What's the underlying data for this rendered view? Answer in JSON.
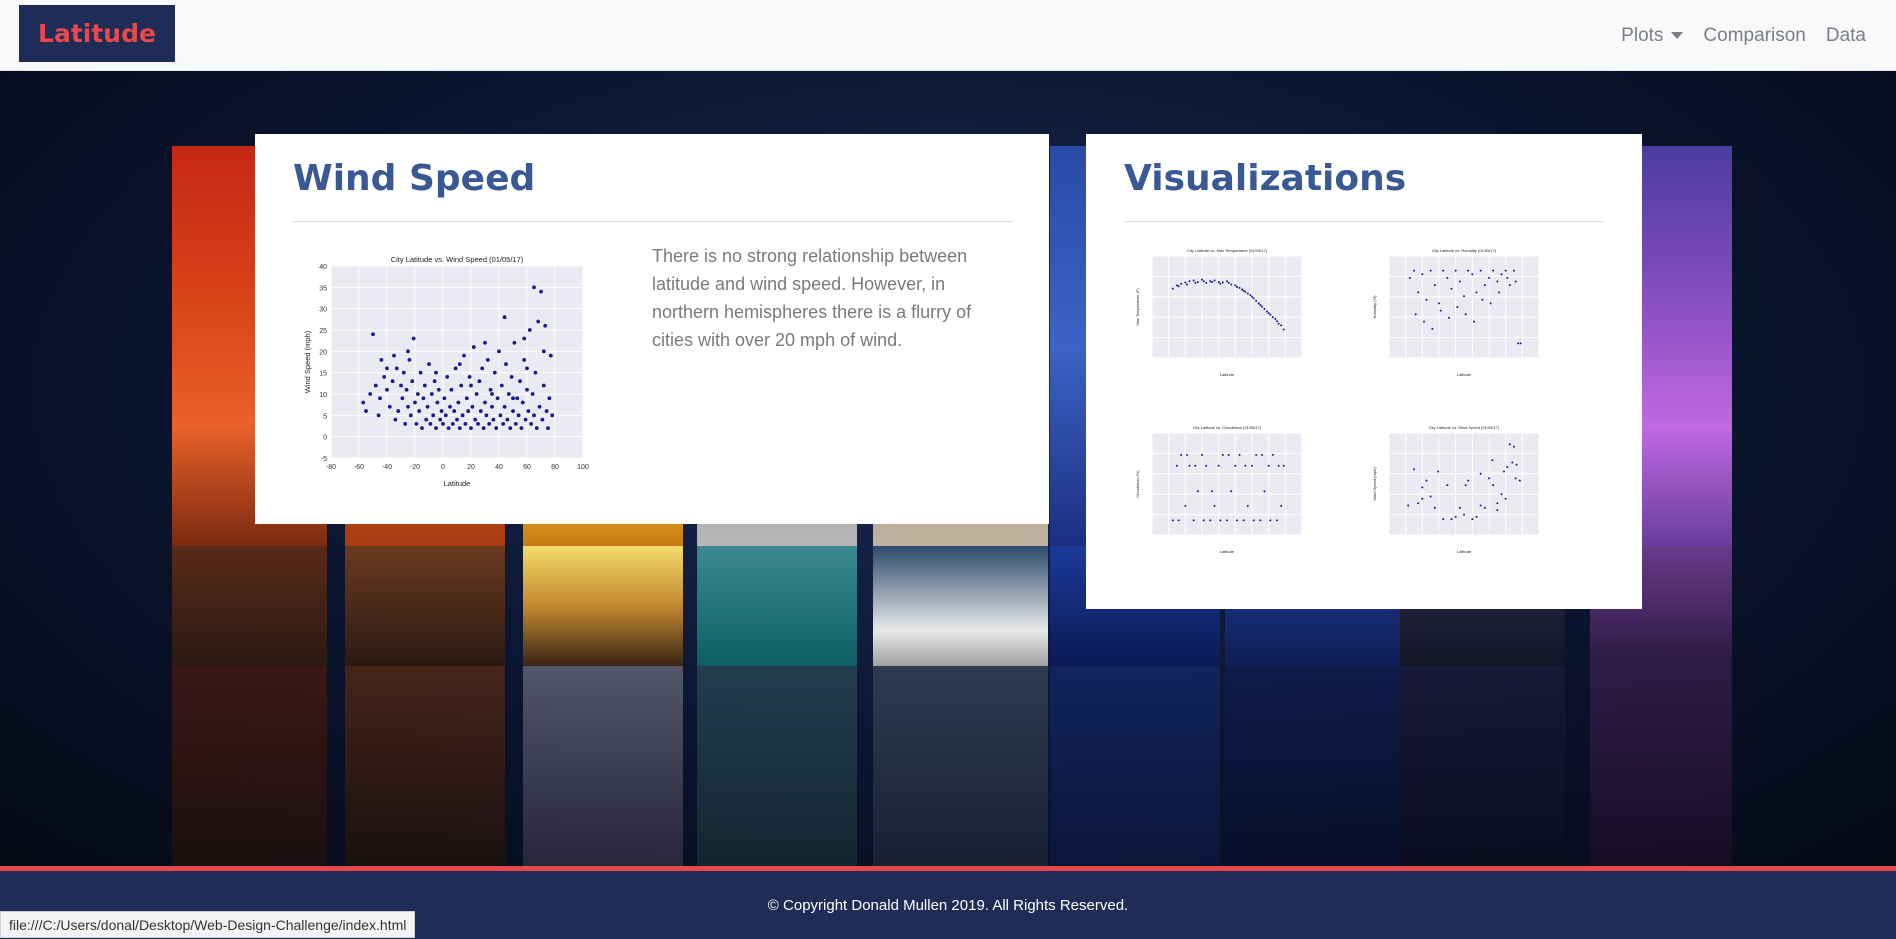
{
  "navbar": {
    "brand": "Latitude",
    "items": [
      {
        "label": "Plots",
        "dropdown": true
      },
      {
        "label": "Comparison"
      },
      {
        "label": "Data"
      }
    ]
  },
  "wind_card": {
    "title": "Wind Speed",
    "description": "There is no strong relationship between latitude and wind speed. However, in northern hemispheres there is a flurry of cities with over 20 mph of wind."
  },
  "vis_card": {
    "title": "Visualizations"
  },
  "footer": {
    "text": "© Copyright Donald Mullen 2019. All Rights Reserved."
  },
  "statusbar": {
    "url": "file:///C:/Users/donal/Desktop/Web-Design-Challenge/index.html"
  },
  "colors": {
    "brand_bg": "#1f2d56",
    "brand_text": "#e8474d",
    "title": "#3a5894",
    "footer_bg": "#1f2d56",
    "footer_accent": "#e8474d",
    "plot_bg": "#eaeaf2",
    "point": "#1a1a8c"
  },
  "chart_data": [
    {
      "type": "scatter",
      "id": "main",
      "title": "City Latitude vs. Wind Speed (01/05/17)",
      "xlabel": "Latitude",
      "ylabel": "Wind Speed (mph)",
      "xlim": [
        -80,
        100
      ],
      "ylim": [
        -5,
        40
      ],
      "xticks": [
        -80,
        -60,
        -40,
        -20,
        0,
        20,
        40,
        60,
        80,
        100
      ],
      "yticks": [
        -5,
        0,
        5,
        10,
        15,
        20,
        25,
        30,
        35,
        40
      ],
      "grid": true,
      "points": [
        [
          -57,
          8
        ],
        [
          -55,
          6
        ],
        [
          -52,
          10
        ],
        [
          -50,
          24
        ],
        [
          -48,
          12
        ],
        [
          -46,
          5
        ],
        [
          -45,
          9
        ],
        [
          -44,
          18
        ],
        [
          -42,
          14
        ],
        [
          -40,
          11
        ],
        [
          -38,
          7
        ],
        [
          -36,
          13
        ],
        [
          -35,
          19
        ],
        [
          -34,
          4
        ],
        [
          -33,
          16
        ],
        [
          -32,
          6
        ],
        [
          -30,
          12
        ],
        [
          -29,
          9
        ],
        [
          -28,
          15
        ],
        [
          -27,
          3
        ],
        [
          -26,
          11
        ],
        [
          -25,
          7
        ],
        [
          -24,
          18
        ],
        [
          -23,
          5
        ],
        [
          -22,
          13
        ],
        [
          -21,
          23
        ],
        [
          -20,
          8
        ],
        [
          -19,
          3
        ],
        [
          -18,
          10
        ],
        [
          -17,
          6
        ],
        [
          -16,
          15
        ],
        [
          -15,
          2
        ],
        [
          -14,
          9
        ],
        [
          -13,
          12
        ],
        [
          -12,
          4
        ],
        [
          -11,
          7
        ],
        [
          -10,
          17
        ],
        [
          -9,
          3
        ],
        [
          -8,
          10
        ],
        [
          -7,
          5
        ],
        [
          -6,
          13
        ],
        [
          -5,
          2
        ],
        [
          -4,
          8
        ],
        [
          -3,
          11
        ],
        [
          -2,
          4
        ],
        [
          -1,
          6
        ],
        [
          0,
          3
        ],
        [
          1,
          9
        ],
        [
          2,
          5
        ],
        [
          3,
          14
        ],
        [
          4,
          2
        ],
        [
          5,
          7
        ],
        [
          6,
          11
        ],
        [
          7,
          3
        ],
        [
          8,
          6
        ],
        [
          9,
          16
        ],
        [
          10,
          4
        ],
        [
          11,
          8
        ],
        [
          12,
          2
        ],
        [
          13,
          12
        ],
        [
          14,
          5
        ],
        [
          15,
          19
        ],
        [
          16,
          3
        ],
        [
          17,
          9
        ],
        [
          18,
          6
        ],
        [
          19,
          14
        ],
        [
          20,
          2
        ],
        [
          21,
          7
        ],
        [
          22,
          21
        ],
        [
          23,
          4
        ],
        [
          24,
          10
        ],
        [
          25,
          3
        ],
        [
          26,
          13
        ],
        [
          27,
          6
        ],
        [
          28,
          16
        ],
        [
          29,
          2
        ],
        [
          30,
          8
        ],
        [
          31,
          5
        ],
        [
          32,
          18
        ],
        [
          33,
          3
        ],
        [
          34,
          11
        ],
        [
          35,
          7
        ],
        [
          36,
          4
        ],
        [
          37,
          15
        ],
        [
          38,
          2
        ],
        [
          39,
          9
        ],
        [
          40,
          20
        ],
        [
          41,
          5
        ],
        [
          42,
          12
        ],
        [
          43,
          3
        ],
        [
          44,
          7
        ],
        [
          45,
          17
        ],
        [
          46,
          4
        ],
        [
          47,
          10
        ],
        [
          48,
          2
        ],
        [
          49,
          14
        ],
        [
          50,
          6
        ],
        [
          51,
          22
        ],
        [
          52,
          3
        ],
        [
          53,
          9
        ],
        [
          54,
          5
        ],
        [
          55,
          13
        ],
        [
          56,
          2
        ],
        [
          57,
          8
        ],
        [
          58,
          18
        ],
        [
          59,
          4
        ],
        [
          60,
          11
        ],
        [
          61,
          6
        ],
        [
          62,
          25
        ],
        [
          63,
          3
        ],
        [
          64,
          10
        ],
        [
          65,
          5
        ],
        [
          66,
          15
        ],
        [
          67,
          2
        ],
        [
          68,
          27
        ],
        [
          69,
          7
        ],
        [
          70,
          34
        ],
        [
          71,
          4
        ],
        [
          72,
          12
        ],
        [
          73,
          26
        ],
        [
          74,
          6
        ],
        [
          75,
          2
        ],
        [
          76,
          9
        ],
        [
          77,
          19
        ],
        [
          78,
          5
        ],
        [
          65,
          35
        ],
        [
          58,
          23
        ],
        [
          44,
          28
        ],
        [
          30,
          22
        ],
        [
          -5,
          15
        ],
        [
          -25,
          20
        ],
        [
          -40,
          16
        ],
        [
          12,
          17
        ],
        [
          20,
          12
        ],
        [
          35,
          10
        ],
        [
          50,
          9
        ],
        [
          60,
          16
        ],
        [
          72,
          20
        ]
      ]
    },
    {
      "type": "scatter",
      "id": "temperature",
      "title": "City Latitude vs. Max Temperature (01/05/17)",
      "xlabel": "Latitude",
      "ylabel": "Max Temperature (F)",
      "xlim": [
        -80,
        100
      ],
      "ylim": [
        -100,
        150
      ],
      "grid": true,
      "points": [
        [
          -55,
          70
        ],
        [
          -50,
          78
        ],
        [
          -45,
          82
        ],
        [
          -40,
          85
        ],
        [
          -35,
          88
        ],
        [
          -30,
          90
        ],
        [
          -25,
          86
        ],
        [
          -20,
          92
        ],
        [
          -15,
          84
        ],
        [
          -10,
          88
        ],
        [
          -5,
          90
        ],
        [
          0,
          86
        ],
        [
          5,
          85
        ],
        [
          10,
          88
        ],
        [
          15,
          80
        ],
        [
          20,
          78
        ],
        [
          25,
          72
        ],
        [
          30,
          65
        ],
        [
          35,
          58
        ],
        [
          40,
          50
        ],
        [
          45,
          40
        ],
        [
          50,
          30
        ],
        [
          55,
          20
        ],
        [
          60,
          10
        ],
        [
          65,
          0
        ],
        [
          70,
          -10
        ],
        [
          75,
          -20
        ],
        [
          78,
          -30
        ],
        [
          -48,
          76
        ],
        [
          -38,
          80
        ],
        [
          -28,
          84
        ],
        [
          -18,
          88
        ],
        [
          -8,
          86
        ],
        [
          2,
          82
        ],
        [
          12,
          84
        ],
        [
          22,
          74
        ],
        [
          32,
          62
        ],
        [
          42,
          46
        ],
        [
          52,
          26
        ],
        [
          62,
          6
        ],
        [
          72,
          -16
        ],
        [
          48,
          34
        ],
        [
          58,
          14
        ],
        [
          68,
          -4
        ],
        [
          38,
          54
        ],
        [
          28,
          68
        ]
      ]
    },
    {
      "type": "scatter",
      "id": "humidity",
      "title": "City Latitude vs. Humidity (01/05/17)",
      "xlabel": "Latitude",
      "ylabel": "Humidity (%)",
      "xlim": [
        -80,
        100
      ],
      "ylim": [
        -20,
        120
      ],
      "grid": true,
      "points": [
        [
          -55,
          90
        ],
        [
          -50,
          100
        ],
        [
          -45,
          70
        ],
        [
          -40,
          95
        ],
        [
          -35,
          60
        ],
        [
          -30,
          100
        ],
        [
          -25,
          80
        ],
        [
          -20,
          55
        ],
        [
          -15,
          100
        ],
        [
          -10,
          90
        ],
        [
          -5,
          75
        ],
        [
          0,
          100
        ],
        [
          5,
          85
        ],
        [
          10,
          65
        ],
        [
          15,
          100
        ],
        [
          20,
          95
        ],
        [
          25,
          70
        ],
        [
          30,
          100
        ],
        [
          35,
          80
        ],
        [
          40,
          90
        ],
        [
          45,
          100
        ],
        [
          50,
          85
        ],
        [
          55,
          95
        ],
        [
          60,
          100
        ],
        [
          65,
          80
        ],
        [
          70,
          100
        ],
        [
          75,
          0
        ],
        [
          78,
          0
        ],
        [
          -48,
          40
        ],
        [
          -38,
          30
        ],
        [
          -28,
          20
        ],
        [
          -18,
          45
        ],
        [
          -8,
          35
        ],
        [
          2,
          50
        ],
        [
          12,
          40
        ],
        [
          22,
          30
        ],
        [
          32,
          60
        ],
        [
          42,
          55
        ],
        [
          52,
          70
        ],
        [
          62,
          90
        ],
        [
          72,
          85
        ]
      ]
    },
    {
      "type": "scatter",
      "id": "cloudiness",
      "title": "City Latitude vs. Cloudiness (01/05/17)",
      "xlabel": "Latitude",
      "ylabel": "Cloudiness (%)",
      "xlim": [
        -80,
        100
      ],
      "ylim": [
        -20,
        120
      ],
      "grid": true,
      "points": [
        [
          -55,
          0
        ],
        [
          -50,
          75
        ],
        [
          -45,
          90
        ],
        [
          -40,
          20
        ],
        [
          -35,
          75
        ],
        [
          -30,
          0
        ],
        [
          -25,
          40
        ],
        [
          -20,
          90
        ],
        [
          -15,
          75
        ],
        [
          -10,
          0
        ],
        [
          -5,
          20
        ],
        [
          0,
          75
        ],
        [
          5,
          90
        ],
        [
          10,
          0
        ],
        [
          15,
          40
        ],
        [
          20,
          75
        ],
        [
          25,
          90
        ],
        [
          30,
          0
        ],
        [
          35,
          20
        ],
        [
          40,
          75
        ],
        [
          45,
          90
        ],
        [
          50,
          0
        ],
        [
          55,
          40
        ],
        [
          60,
          75
        ],
        [
          65,
          90
        ],
        [
          70,
          0
        ],
        [
          75,
          20
        ],
        [
          78,
          75
        ],
        [
          -48,
          0
        ],
        [
          -38,
          90
        ],
        [
          -28,
          75
        ],
        [
          -18,
          0
        ],
        [
          -8,
          40
        ],
        [
          2,
          0
        ],
        [
          12,
          90
        ],
        [
          22,
          0
        ],
        [
          32,
          75
        ],
        [
          42,
          0
        ],
        [
          52,
          90
        ],
        [
          62,
          0
        ],
        [
          72,
          75
        ]
      ]
    },
    {
      "type": "scatter",
      "id": "wind-thumb",
      "title": "City Latitude vs. Wind Speed (01/05/17)",
      "xlabel": "Latitude",
      "ylabel": "Wind Speed (mph)",
      "xlim": [
        -80,
        100
      ],
      "ylim": [
        -5,
        40
      ],
      "grid": true,
      "points": [
        [
          -57,
          8
        ],
        [
          -50,
          24
        ],
        [
          -45,
          9
        ],
        [
          -40,
          11
        ],
        [
          -35,
          19
        ],
        [
          -30,
          12
        ],
        [
          -25,
          7
        ],
        [
          -21,
          23
        ],
        [
          -15,
          2
        ],
        [
          -10,
          17
        ],
        [
          -5,
          2
        ],
        [
          0,
          3
        ],
        [
          5,
          7
        ],
        [
          10,
          4
        ],
        [
          15,
          19
        ],
        [
          20,
          2
        ],
        [
          25,
          3
        ],
        [
          30,
          8
        ],
        [
          35,
          7
        ],
        [
          40,
          20
        ],
        [
          45,
          17
        ],
        [
          50,
          6
        ],
        [
          55,
          13
        ],
        [
          60,
          11
        ],
        [
          62,
          25
        ],
        [
          65,
          35
        ],
        [
          68,
          27
        ],
        [
          70,
          34
        ],
        [
          73,
          26
        ],
        [
          77,
          19
        ],
        [
          58,
          23
        ],
        [
          44,
          28
        ],
        [
          30,
          22
        ],
        [
          -40,
          16
        ],
        [
          12,
          17
        ],
        [
          50,
          9
        ],
        [
          72,
          20
        ]
      ]
    }
  ]
}
